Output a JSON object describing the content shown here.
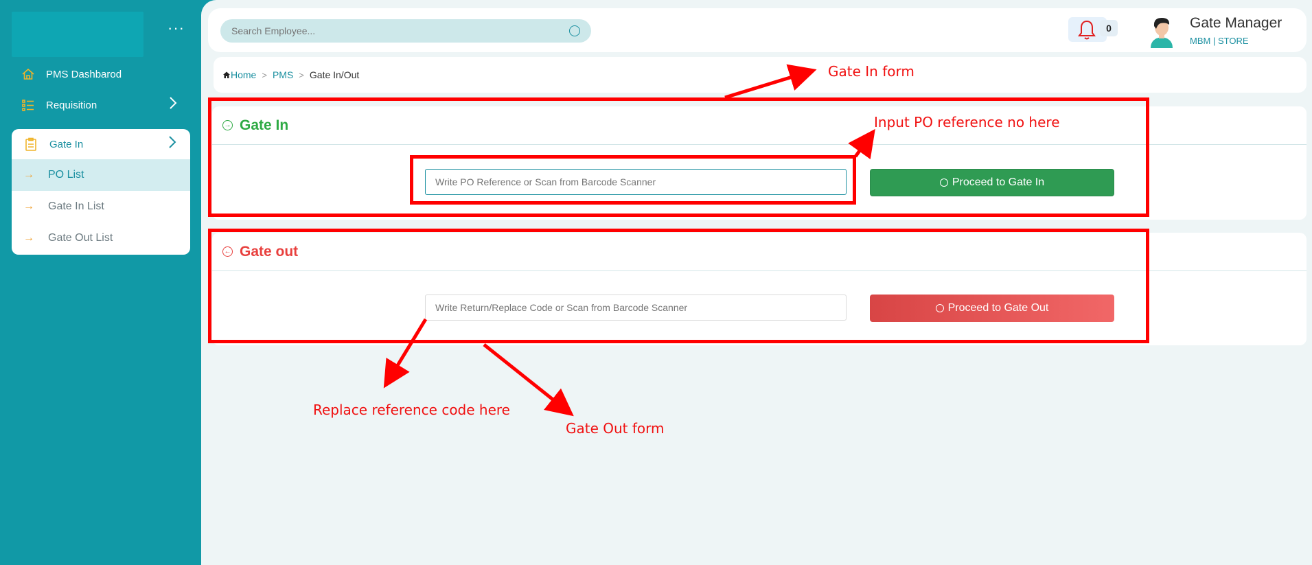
{
  "sidebar": {
    "more_label": "···",
    "nav": [
      {
        "label": "PMS Dashbarod",
        "icon": "home-icon"
      },
      {
        "label": "Requisition",
        "icon": "list-icon"
      }
    ],
    "submenu": {
      "label": "Gate In",
      "icon": "clipboard-icon",
      "items": [
        {
          "label": "PO List",
          "active": true
        },
        {
          "label": "Gate In List",
          "active": false
        },
        {
          "label": "Gate Out List",
          "active": false
        }
      ]
    }
  },
  "header": {
    "search_placeholder": "Search Employee...",
    "notification_count": "0",
    "user_name": "Gate Manager",
    "user_org": "MBM",
    "user_dept": "| STORE"
  },
  "breadcrumb": {
    "home": "Home",
    "section": "PMS",
    "current": "Gate In/Out"
  },
  "gate_in": {
    "title": "Gate In",
    "input_placeholder": "Write PO Reference or Scan from Barcode Scanner",
    "button_label": "Proceed to Gate In"
  },
  "gate_out": {
    "title": "Gate out",
    "input_placeholder": "Write Return/Replace Code or Scan from Barcode Scanner",
    "button_label": "Proceed to Gate Out"
  },
  "annotations": {
    "gate_in_form": "Gate In form",
    "input_po": "Input PO reference no here",
    "replace_code": "Replace reference code here",
    "gate_out_form": "Gate Out form"
  },
  "colors": {
    "sidebar": "#1199a6",
    "accent": "#1a8fa0",
    "green": "#2f9b53",
    "red": "#e8403e",
    "annotation": "#ff0000"
  }
}
